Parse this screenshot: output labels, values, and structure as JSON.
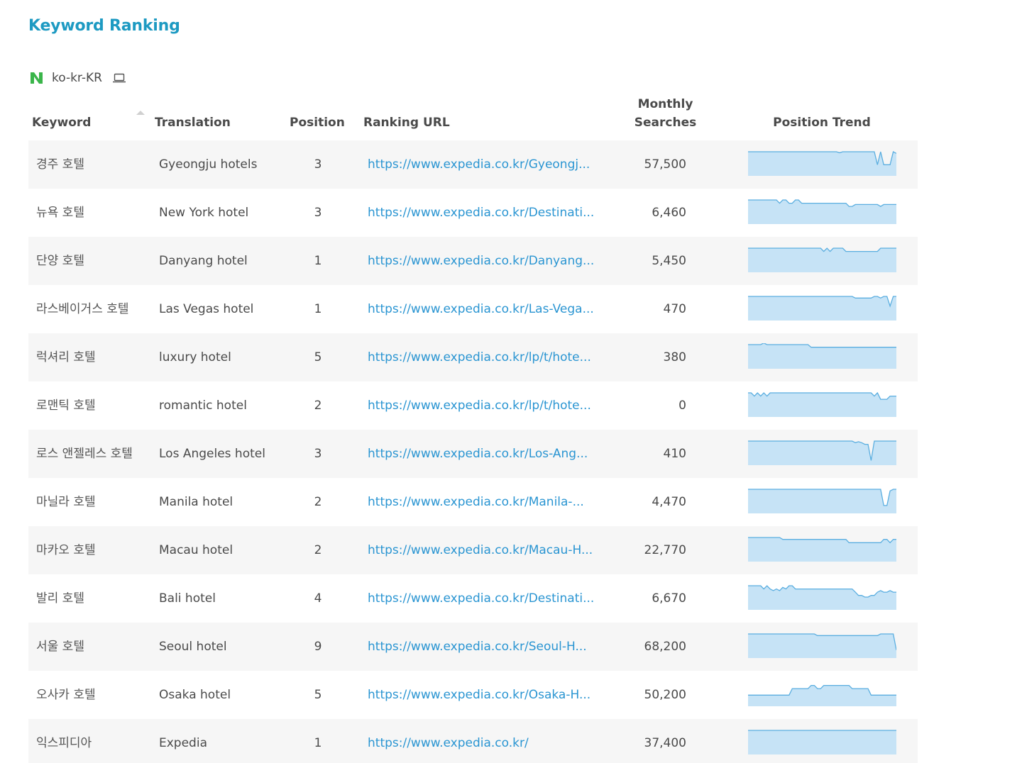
{
  "title": "Keyword Ranking",
  "locale": {
    "search_engine_icon": "naver-n-icon",
    "code": "ko-kr-KR",
    "device_icon": "laptop-icon"
  },
  "colors": {
    "title": "#1d9ac2",
    "link": "#2a95d2",
    "trend_fill": "#c6e3f6",
    "trend_line": "#5aaee0",
    "naver_green": "#3ab54a"
  },
  "table": {
    "headers": {
      "keyword": "Keyword",
      "translation": "Translation",
      "position": "Position",
      "url": "Ranking URL",
      "searches_line1": "Monthly",
      "searches_line2": "Searches",
      "trend": "Position Trend"
    },
    "sort_indicator_icon": "sort-ascending-icon",
    "rows": [
      {
        "keyword": "경주 호텔",
        "translation": "Gyeongju hotels",
        "position": "3",
        "url": "https://www.expedia.co.kr/Gyeongj...",
        "searches": "57,500",
        "trend": [
          1,
          1,
          1,
          1,
          1,
          1,
          1,
          1,
          1,
          1,
          1,
          1,
          1,
          1,
          1,
          1,
          1,
          1,
          1,
          1,
          1,
          1,
          1,
          1,
          1,
          1,
          1,
          1,
          1,
          1.3,
          1,
          1,
          1,
          1,
          1,
          1,
          1,
          1,
          1,
          1,
          1,
          5,
          1,
          5,
          5,
          5,
          1,
          1.5
        ]
      },
      {
        "keyword": "뉴욕 호텔",
        "translation": "New York hotel",
        "position": "3",
        "url": "https://www.expedia.co.kr/Destinati...",
        "searches": "6,460",
        "trend": [
          1,
          1,
          1,
          1,
          1,
          1,
          1,
          1,
          1,
          1,
          2,
          1,
          1,
          2,
          2,
          1,
          1,
          2,
          2,
          2,
          2,
          2,
          2,
          2,
          2,
          2,
          2,
          2,
          2,
          2,
          2,
          2,
          3,
          3,
          2.4,
          2.4,
          2.4,
          2.4,
          2.4,
          2.4,
          2.4,
          2.4,
          3,
          2.4,
          2.4,
          2.4,
          2.4,
          2.4
        ]
      },
      {
        "keyword": "단양 호텔",
        "translation": "Danyang hotel",
        "position": "1",
        "url": "https://www.expedia.co.kr/Danyang...",
        "searches": "5,450",
        "trend": [
          1,
          1,
          1,
          1,
          1,
          1,
          1,
          1,
          1,
          1,
          1,
          1,
          1,
          1,
          1,
          1,
          1,
          1,
          1,
          1,
          1,
          1,
          1,
          1,
          2,
          1,
          2,
          1,
          1,
          1,
          1,
          2,
          2,
          2,
          2,
          2,
          2,
          2,
          2,
          2,
          2,
          2,
          1,
          1,
          1,
          1,
          1,
          1
        ]
      },
      {
        "keyword": "라스베이거스 호텔",
        "translation": "Las Vegas hotel",
        "position": "1",
        "url": "https://www.expedia.co.kr/Las-Vega...",
        "searches": "470",
        "trend": [
          1,
          1,
          1,
          1,
          1,
          1,
          1,
          1,
          1,
          1,
          1,
          1,
          1,
          1,
          1,
          1,
          1,
          1,
          1,
          1,
          1,
          1,
          1,
          1,
          1,
          1,
          1,
          1,
          1,
          1,
          1,
          1,
          1,
          1,
          1.5,
          1.5,
          1.5,
          1.5,
          1.5,
          1.5,
          1,
          1,
          1.5,
          1,
          1,
          4,
          1,
          1
        ]
      },
      {
        "keyword": "럭셔리 호텔",
        "translation": "luxury hotel",
        "position": "5",
        "url": "https://www.expedia.co.kr/lp/t/hote...",
        "searches": "380",
        "trend": [
          1,
          1,
          1,
          1,
          1,
          0.5,
          1,
          1,
          1,
          1,
          1,
          1,
          1,
          1,
          1,
          1,
          1,
          1,
          1,
          1,
          1.8,
          1.8,
          1.8,
          1.8,
          1.8,
          1.8,
          1.8,
          1.8,
          1.8,
          1.8,
          1.8,
          1.8,
          1.8,
          1.8,
          1.8,
          1.8,
          1.8,
          1.8,
          1.8,
          1.8,
          1.8,
          1.8,
          1.8,
          1.8,
          1.8,
          1.8,
          1.8,
          1.8
        ]
      },
      {
        "keyword": "로맨틱 호텔",
        "translation": "romantic hotel",
        "position": "2",
        "url": "https://www.expedia.co.kr/lp/t/hote...",
        "searches": "0",
        "trend": [
          1,
          1,
          2,
          1,
          2,
          1,
          2,
          1,
          1,
          1,
          1,
          1,
          1,
          1,
          1,
          1,
          1,
          1,
          1,
          1,
          1,
          1,
          1,
          1,
          1,
          1,
          1,
          1,
          1,
          1,
          1,
          1,
          1,
          1,
          1,
          1,
          1,
          1,
          1,
          1,
          2,
          1,
          3,
          3,
          3,
          2,
          2,
          2
        ]
      },
      {
        "keyword": "로스 앤젤레스 호텔",
        "translation": "Los Angeles hotel",
        "position": "3",
        "url": "https://www.expedia.co.kr/Los-Ang...",
        "searches": "410",
        "trend": [
          1,
          1,
          1,
          1,
          1,
          1,
          1,
          1,
          1,
          1,
          1,
          1,
          1,
          1,
          1,
          1,
          1,
          1,
          1,
          1,
          1,
          1,
          1,
          1,
          1,
          1,
          1,
          1,
          1,
          1,
          1,
          1,
          1,
          1,
          1.5,
          1.2,
          1.5,
          2,
          2,
          7,
          1,
          1,
          1,
          1,
          1,
          1,
          1,
          1
        ]
      },
      {
        "keyword": "마닐라 호텔",
        "translation": "Manila hotel",
        "position": "2",
        "url": "https://www.expedia.co.kr/Manila-...",
        "searches": "4,470",
        "trend": [
          1,
          1,
          1,
          1,
          1,
          1,
          1,
          1,
          1,
          1,
          1,
          1,
          1,
          1,
          1,
          1,
          1,
          1,
          1,
          1,
          1,
          1,
          1,
          1,
          1,
          1,
          1,
          1,
          1,
          1,
          1,
          1,
          1,
          1,
          1,
          1,
          1,
          1,
          1,
          1,
          1,
          1,
          1,
          6,
          6,
          1.5,
          1,
          1
        ]
      },
      {
        "keyword": "마카오 호텔",
        "translation": "Macau hotel",
        "position": "2",
        "url": "https://www.expedia.co.kr/Macau-H...",
        "searches": "22,770",
        "trend": [
          1,
          1,
          1,
          1,
          1,
          1,
          1,
          1,
          1,
          1,
          1,
          1.6,
          1.6,
          1.6,
          1.6,
          1.6,
          1.6,
          1.6,
          1.6,
          1.6,
          1.6,
          1.6,
          1.6,
          1.6,
          1.6,
          1.6,
          1.6,
          1.6,
          1.6,
          1.6,
          1.6,
          1.6,
          2.6,
          2.6,
          2.6,
          2.6,
          2.6,
          2.6,
          2.6,
          2.6,
          2.6,
          2.6,
          2.6,
          1.6,
          1.6,
          2.6,
          1.6,
          1.6
        ]
      },
      {
        "keyword": "발리 호텔",
        "translation": "Bali hotel",
        "position": "4",
        "url": "https://www.expedia.co.kr/Destinati...",
        "searches": "6,670",
        "trend": [
          1,
          1,
          1,
          1,
          1,
          2,
          1,
          2,
          2.5,
          2,
          2.5,
          1.5,
          2,
          1,
          1,
          2,
          2,
          2,
          2,
          2,
          2,
          2,
          2,
          2,
          2,
          2,
          2,
          2,
          2,
          2,
          2,
          2,
          2,
          2,
          3,
          4,
          4,
          4.5,
          4.5,
          4,
          4,
          3,
          2.5,
          3,
          3,
          2.5,
          3,
          3
        ]
      },
      {
        "keyword": "서울 호텔",
        "translation": "Seoul hotel",
        "position": "9",
        "url": "https://www.expedia.co.kr/Seoul-H...",
        "searches": "68,200",
        "trend": [
          1,
          1,
          1,
          1,
          1,
          1,
          1,
          1,
          1,
          1,
          1,
          1,
          1,
          1,
          1,
          1,
          1,
          1,
          1,
          1,
          1,
          1,
          1.5,
          1.5,
          1.5,
          1.5,
          1.5,
          1.5,
          1.5,
          1.5,
          1.5,
          1.5,
          1.5,
          1.5,
          1.5,
          1.5,
          1.5,
          1.5,
          1.5,
          1.5,
          1.5,
          1.5,
          1,
          1,
          1,
          1,
          1,
          6
        ]
      },
      {
        "keyword": "오사카 호텔",
        "translation": "Osaka hotel",
        "position": "5",
        "url": "https://www.expedia.co.kr/Osaka-H...",
        "searches": "50,200",
        "trend": [
          5,
          5,
          5,
          5,
          5,
          5,
          5,
          5,
          5,
          5,
          5,
          5,
          5,
          5,
          3,
          3,
          3,
          3,
          3,
          3,
          2,
          2,
          3,
          3,
          2,
          2,
          2,
          2,
          2,
          2,
          2,
          2,
          2,
          3,
          3,
          3,
          3,
          3,
          3,
          5,
          5,
          5,
          5,
          5,
          5,
          5,
          5,
          5
        ]
      },
      {
        "keyword": "익스피디아",
        "translation": "Expedia",
        "position": "1",
        "url": "https://www.expedia.co.kr/",
        "searches": "37,400",
        "trend": [
          1,
          1,
          1,
          1,
          1,
          1,
          1,
          1,
          1,
          1,
          1,
          1,
          1,
          1,
          1,
          1,
          1,
          1,
          1,
          1,
          1,
          1,
          1,
          1,
          1,
          1,
          1,
          1,
          1,
          1,
          1,
          1,
          1,
          1,
          1,
          1,
          1,
          1,
          1,
          1,
          1,
          1,
          1,
          1,
          1,
          1,
          1,
          1
        ]
      }
    ]
  }
}
